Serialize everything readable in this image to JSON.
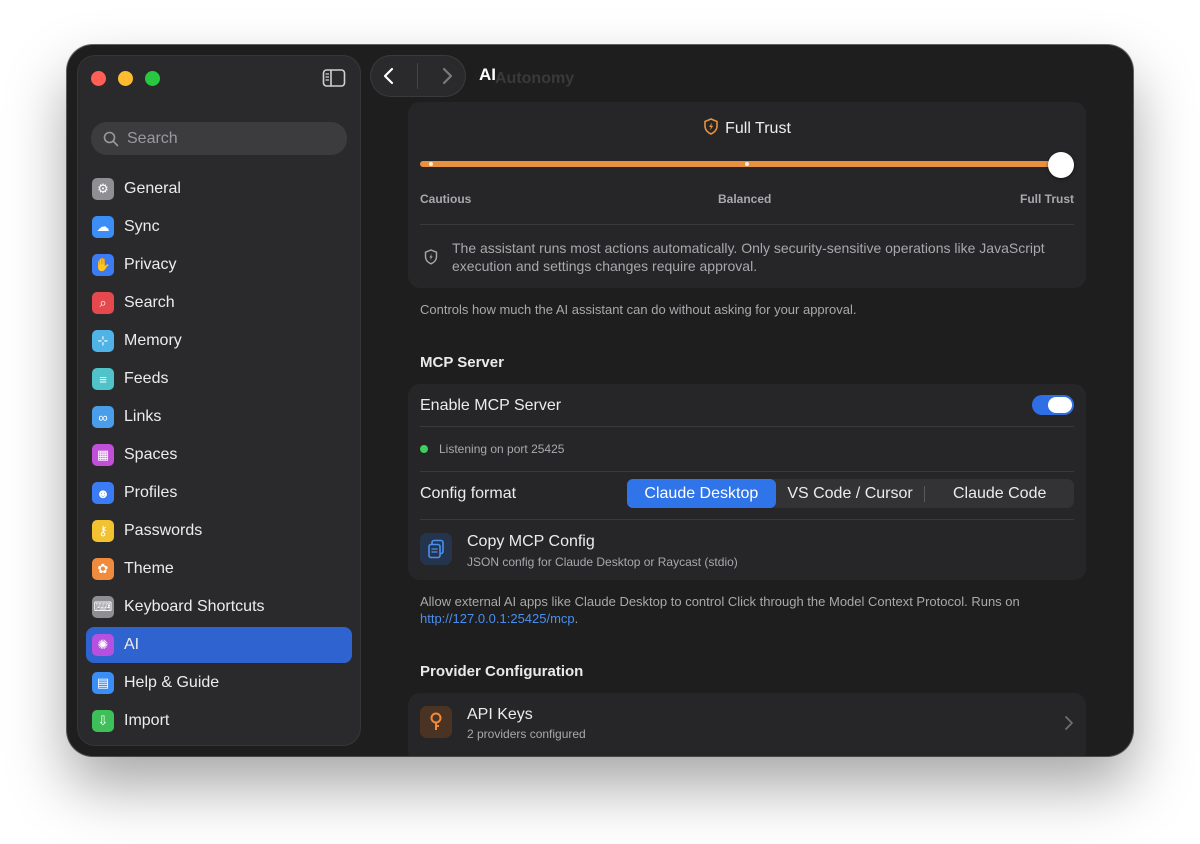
{
  "window": {
    "title": "AI",
    "ghost_title": "Autonomy"
  },
  "sidebar": {
    "search_placeholder": "Search",
    "items": [
      {
        "label": "General",
        "icon": "gear-icon",
        "color": "#8e8e93",
        "glyph": "⚙"
      },
      {
        "label": "Sync",
        "icon": "cloud-icon",
        "color": "#3b8ef5",
        "glyph": "☁"
      },
      {
        "label": "Privacy",
        "icon": "hand-icon",
        "color": "#3b7cf5",
        "glyph": "✋"
      },
      {
        "label": "Search",
        "icon": "magnifier-icon",
        "color": "#e5484d",
        "glyph": "⌕"
      },
      {
        "label": "Memory",
        "icon": "memory-icon",
        "color": "#4fb3e8",
        "glyph": "⊹"
      },
      {
        "label": "Feeds",
        "icon": "feeds-icon",
        "color": "#4fc3c9",
        "glyph": "≡"
      },
      {
        "label": "Links",
        "icon": "link-icon",
        "color": "#4a9de8",
        "glyph": "∞"
      },
      {
        "label": "Spaces",
        "icon": "spaces-icon",
        "color": "#c24fd8",
        "glyph": "▦"
      },
      {
        "label": "Profiles",
        "icon": "profiles-icon",
        "color": "#3b7cf5",
        "glyph": "☻"
      },
      {
        "label": "Passwords",
        "icon": "key-icon",
        "color": "#f2c230",
        "glyph": "⚷"
      },
      {
        "label": "Theme",
        "icon": "palette-icon",
        "color": "#f08a3c",
        "glyph": "✿"
      },
      {
        "label": "Keyboard Shortcuts",
        "icon": "keyboard-icon",
        "color": "#8e8e93",
        "glyph": "⌨"
      },
      {
        "label": "AI",
        "icon": "ai-icon",
        "color": "#b650e0",
        "glyph": "✺",
        "active": true
      },
      {
        "label": "Help & Guide",
        "icon": "book-icon",
        "color": "#3b8ef5",
        "glyph": "▤"
      },
      {
        "label": "Import",
        "icon": "import-icon",
        "color": "#3fbf5a",
        "glyph": "⇩"
      }
    ]
  },
  "trust": {
    "heading": "Full Trust",
    "level_index": 2,
    "labels": [
      "Cautious",
      "Balanced",
      "Full Trust"
    ],
    "description": "The assistant runs most actions automatically. Only security-sensitive operations like JavaScript execution and settings changes require approval.",
    "help": "Controls how much the AI assistant can do without asking for your approval."
  },
  "mcp": {
    "section_title": "MCP Server",
    "enable_label": "Enable MCP Server",
    "enabled": true,
    "status": "Listening on port 25425",
    "config_label": "Config format",
    "formats": [
      "Claude Desktop",
      "VS Code / Cursor",
      "Claude Code"
    ],
    "selected_format": "Claude Desktop",
    "copy_title": "Copy MCP Config",
    "copy_sub": "JSON config for Claude Desktop or Raycast (stdio)",
    "help_prefix": "Allow external AI apps like Claude Desktop to control Click through the Model Context Protocol. Runs on",
    "help_url": "http://127.0.0.1:25425/mcp",
    "help_suffix": "."
  },
  "provider": {
    "section_title": "Provider Configuration",
    "api_title": "API Keys",
    "api_sub": "2 providers configured"
  },
  "colors": {
    "accent": "#2f64d0",
    "slider": "#e8913f",
    "toggle": "#2f6fe6",
    "status_green": "#3fcf5c"
  }
}
